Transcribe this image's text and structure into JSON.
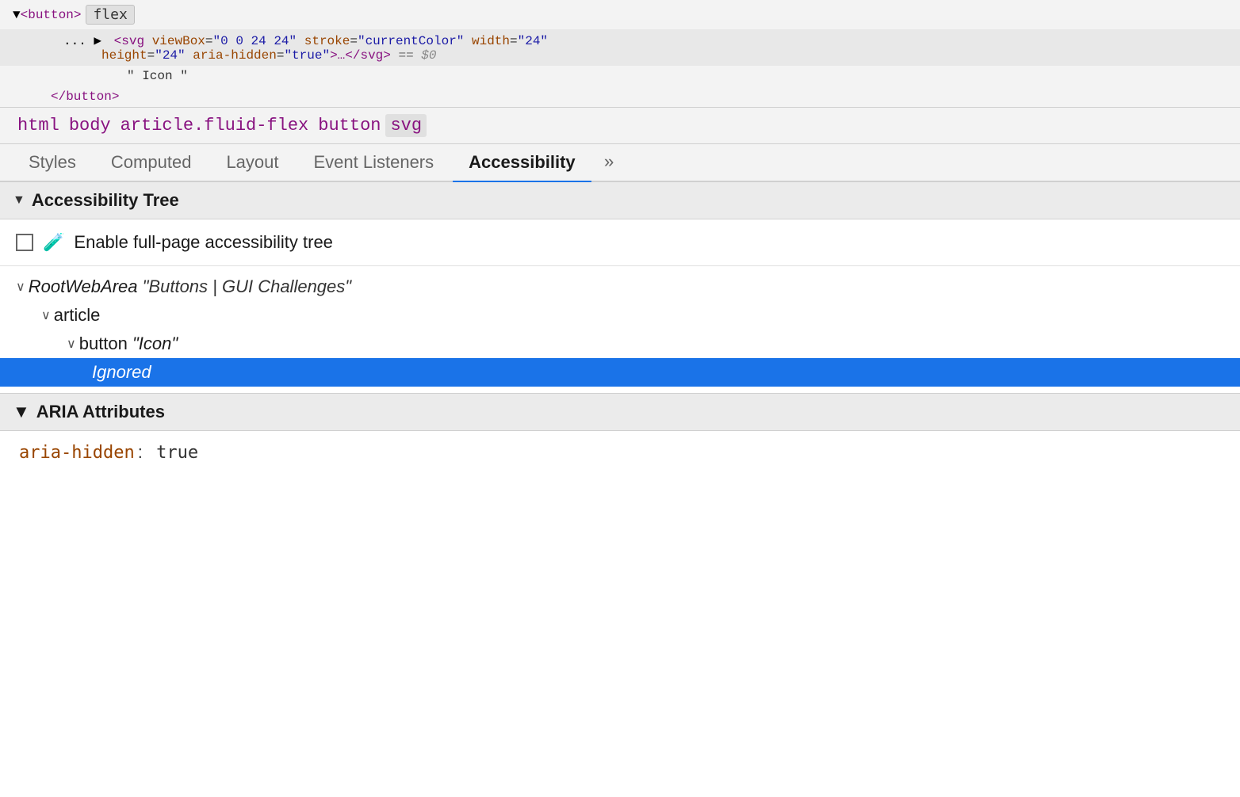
{
  "dom_inspector": {
    "line1": {
      "triangle": "▼",
      "tag_open": "<button>",
      "badge": "flex"
    },
    "line2": {
      "ellipsis": "...",
      "triangle": "▶",
      "attr_parts": [
        {
          "type": "tag_open",
          "text": "<svg "
        },
        {
          "type": "attr_name",
          "text": "viewBox"
        },
        {
          "type": "attr_equals",
          "text": "="
        },
        {
          "type": "attr_value",
          "text": "\"0 0 24 24\""
        },
        {
          "type": "attr_name",
          "text": " stroke"
        },
        {
          "type": "attr_equals",
          "text": "="
        },
        {
          "type": "attr_value",
          "text": "\"currentColor\""
        },
        {
          "type": "attr_name",
          "text": " width"
        },
        {
          "type": "attr_equals",
          "text": "="
        },
        {
          "type": "attr_value",
          "text": "\"24\""
        }
      ],
      "line2b_attr": [
        {
          "type": "attr_name",
          "text": "height"
        },
        {
          "type": "attr_equals",
          "text": "="
        },
        {
          "type": "attr_value",
          "text": "\"24\""
        },
        {
          "type": "attr_name",
          "text": " aria-hidden"
        },
        {
          "type": "attr_equals",
          "text": "="
        },
        {
          "type": "attr_value",
          "text": "\"true\""
        },
        {
          "type": "tag_close",
          "text": ">…</svg>"
        },
        {
          "type": "dollar_zero",
          "text": " == $0"
        }
      ]
    },
    "line3": {
      "text": "\" Icon \""
    },
    "line4": {
      "closing_tag": "</button>"
    }
  },
  "breadcrumb": {
    "items": [
      {
        "label": "html",
        "active": false
      },
      {
        "label": "body",
        "active": false
      },
      {
        "label": "article.fluid-flex",
        "active": false
      },
      {
        "label": "button",
        "active": false
      },
      {
        "label": "svg",
        "active": true
      }
    ]
  },
  "tabs": {
    "items": [
      {
        "label": "Styles",
        "active": false
      },
      {
        "label": "Computed",
        "active": false
      },
      {
        "label": "Layout",
        "active": false
      },
      {
        "label": "Event Listeners",
        "active": false
      },
      {
        "label": "Accessibility",
        "active": true
      },
      {
        "label": "»",
        "active": false
      }
    ]
  },
  "accessibility_section": {
    "title": "Accessibility Tree",
    "full_page_label": "Enable full-page accessibility tree",
    "tree": [
      {
        "id": "root-web-area",
        "indent": 0,
        "chevron": "∨",
        "label": "RootWebArea",
        "value": "\"Buttons | GUI Challenges\"",
        "italic": true,
        "selected": false
      },
      {
        "id": "article-node",
        "indent": 1,
        "chevron": "∨",
        "label": "article",
        "value": "",
        "italic": false,
        "selected": false
      },
      {
        "id": "button-node",
        "indent": 2,
        "chevron": "∨",
        "label": "button",
        "value": "\"Icon\"",
        "italic": false,
        "selected": false
      },
      {
        "id": "ignored-node",
        "indent": 3,
        "chevron": "",
        "label": "Ignored",
        "value": "",
        "italic": true,
        "selected": true
      }
    ]
  },
  "aria_section": {
    "title": "ARIA Attributes",
    "attributes": [
      {
        "name": "aria-hidden",
        "colon": ":",
        "value": "true"
      }
    ]
  }
}
